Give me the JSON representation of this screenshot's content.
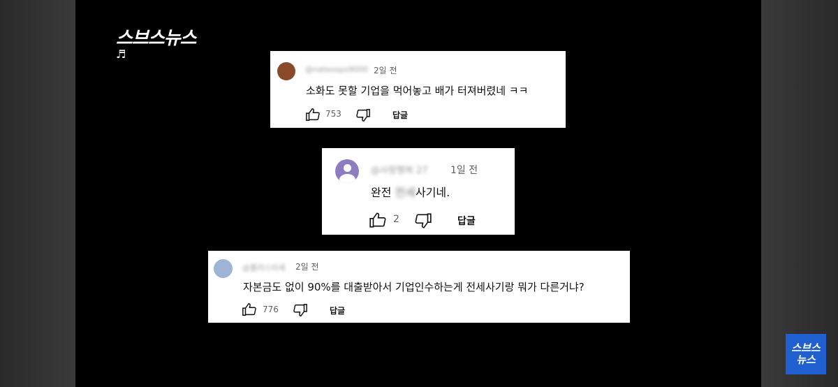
{
  "header": {
    "logo": "스브스뉴스",
    "note_icon": "♬"
  },
  "corner_badge": {
    "line1": "스브스",
    "line2": "뉴스"
  },
  "comments": [
    {
      "author": "@nateoops9000",
      "time": "2일 전",
      "text": "소화도 못할 기업을 먹어놓고 배가 터져버렸네 ㅋㅋ",
      "likes": "753",
      "reply": "답글",
      "avatar_color": "#8a4a2a"
    },
    {
      "author": "@사랑행복 27",
      "time": "1일 전",
      "text_prefix": "완전 ",
      "text_blur": "전세",
      "text_suffix": "사기네.",
      "likes": "2",
      "reply": "답글",
      "avatar_color": "#8e7cc3"
    },
    {
      "author": "@플러스미세",
      "time": "2일 전",
      "text": "자본금도 없이 90%를 대출받아서 기업인수하는게 전세사기랑 뭐가 다른거냐?",
      "likes": "776",
      "reply": "답글",
      "avatar_color": "#9fb3d6"
    }
  ]
}
